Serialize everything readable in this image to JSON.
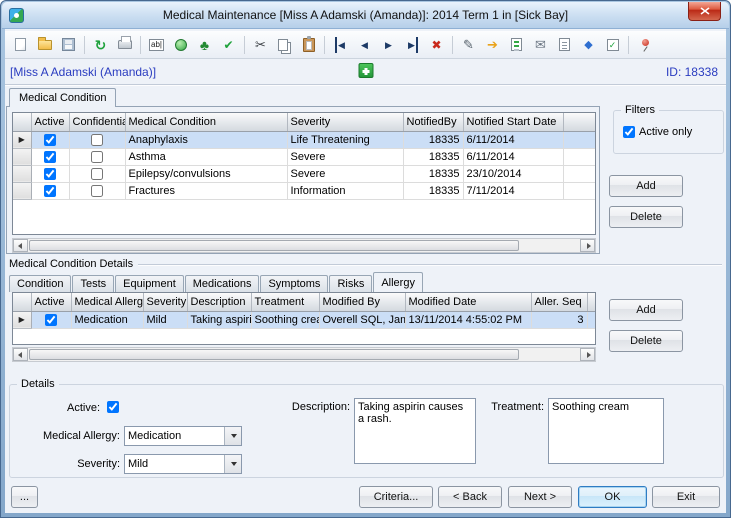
{
  "window": {
    "title": "Medical Maintenance   [Miss A Adamski (Amanda)]: 2014 Term 1 in [Sick Bay]",
    "student": "[Miss A Adamski (Amanda)]",
    "record_id": "ID: 18338"
  },
  "toolbar": {
    "icons": [
      {
        "name": "new-document",
        "glyph": ""
      },
      {
        "name": "open-folder",
        "glyph": ""
      },
      {
        "name": "save",
        "glyph": ""
      },
      {
        "name": "refresh",
        "glyph": "↻"
      },
      {
        "name": "print",
        "glyph": ""
      },
      {
        "name": "find-replace",
        "glyph": "ab|"
      },
      {
        "name": "hint",
        "glyph": ""
      },
      {
        "name": "tree-view",
        "glyph": "♣"
      },
      {
        "name": "spell-check",
        "glyph": "✔"
      },
      {
        "name": "cut",
        "glyph": "✂"
      },
      {
        "name": "copy",
        "glyph": ""
      },
      {
        "name": "paste",
        "glyph": ""
      },
      {
        "name": "first-record",
        "glyph": "◀"
      },
      {
        "name": "previous-record",
        "glyph": "◀"
      },
      {
        "name": "next-record",
        "glyph": "▶"
      },
      {
        "name": "last-record",
        "glyph": "▶"
      },
      {
        "name": "delete-record",
        "glyph": "✖"
      },
      {
        "name": "edit-document",
        "glyph": "✎"
      },
      {
        "name": "launch",
        "glyph": "➔"
      },
      {
        "name": "import",
        "glyph": ""
      },
      {
        "name": "email",
        "glyph": "✉"
      },
      {
        "name": "audit",
        "glyph": ""
      },
      {
        "name": "field-lookup",
        "glyph": "◆"
      },
      {
        "name": "task-list",
        "glyph": "✓"
      },
      {
        "name": "pin",
        "glyph": ""
      }
    ]
  },
  "main_tab_label": "Medical Condition",
  "conditions_grid": {
    "selector_glyph": "▶",
    "selected_index": 0,
    "headers": {
      "active": "Active",
      "confidential": "Confidential",
      "condition": "Medical Condition",
      "severity": "Severity",
      "notified_by": "NotifiedBy",
      "start_date": "Notified Start Date"
    },
    "rows": [
      {
        "active": true,
        "confidential": false,
        "condition": "Anaphylaxis",
        "severity": "Life Threatening",
        "notified_by": "18335",
        "start_date": "6/11/2014"
      },
      {
        "active": true,
        "confidential": false,
        "condition": "Asthma",
        "severity": "Severe",
        "notified_by": "18335",
        "start_date": "6/11/2014"
      },
      {
        "active": true,
        "confidential": false,
        "condition": "Epilepsy/convulsions",
        "severity": "Severe",
        "notified_by": "18335",
        "start_date": "23/10/2014"
      },
      {
        "active": true,
        "confidential": false,
        "condition": "Fractures",
        "severity": "Information",
        "notified_by": "18335",
        "start_date": "7/11/2014"
      }
    ]
  },
  "filters": {
    "title": "Filters",
    "active_only_label": "Active only",
    "active_only_checked": true
  },
  "condition_buttons": {
    "add": "Add",
    "delete": "Delete"
  },
  "details_section": {
    "title": "Medical Condition Details",
    "tabs": [
      "Condition",
      "Tests",
      "Equipment",
      "Medications",
      "Symptoms",
      "Risks",
      "Allergy"
    ],
    "selected_tab": "Allergy"
  },
  "allergy_grid": {
    "selector_glyph": "▶",
    "selected_index": 0,
    "headers": {
      "active": "Active",
      "medical_allergy": "Medical Allergy",
      "severity": "Severity",
      "description": "Description",
      "treatment": "Treatment",
      "modified_by": "Modified By",
      "modified_date": "Modified Date",
      "seq": "Aller. Seq"
    },
    "rows": [
      {
        "active": true,
        "medical_allergy": "Medication",
        "severity": "Mild",
        "description": "Taking aspirin causes a rash.",
        "treatment": "Soothing cream",
        "modified_by": "Overell SQL, James",
        "modified_date": "13/11/2014 4:55:02 PM",
        "seq": "3"
      }
    ]
  },
  "allergy_buttons": {
    "add": "Add",
    "delete": "Delete"
  },
  "details_form": {
    "title": "Details",
    "active_label": "Active:",
    "active_checked": true,
    "medical_allergy_label": "Medical Allergy:",
    "medical_allergy_value": "Medication",
    "severity_label": "Severity:",
    "severity_value": "Mild",
    "description_label": "Description:",
    "description_value": "Taking aspirin causes a rash.",
    "treatment_label": "Treatment:",
    "treatment_value": "Soothing cream"
  },
  "footer": {
    "more": "...",
    "criteria": "Criteria...",
    "back": "< Back",
    "next": "Next >",
    "ok": "OK",
    "exit": "Exit"
  }
}
